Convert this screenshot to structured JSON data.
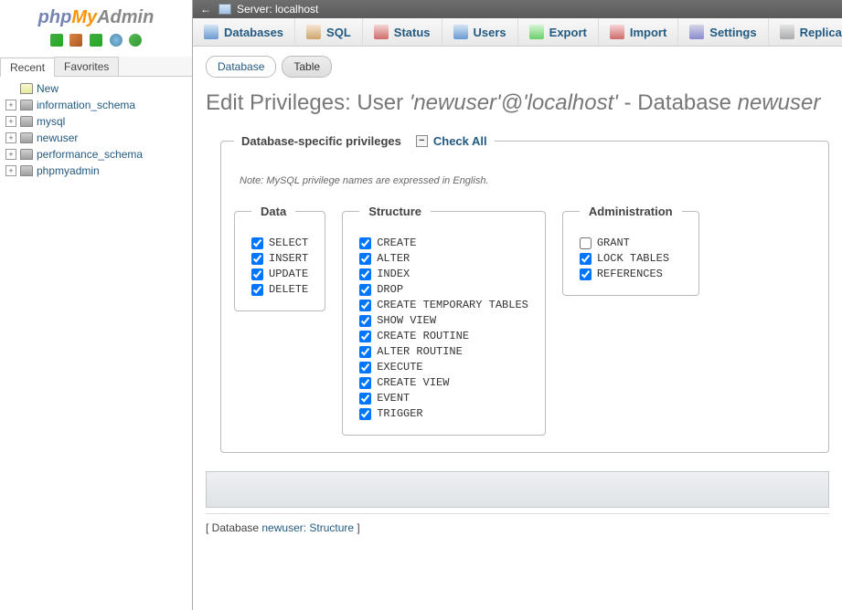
{
  "logo": {
    "php": "php",
    "my": "My",
    "admin": "Admin"
  },
  "sidebar": {
    "tabs": {
      "recent": "Recent",
      "favorites": "Favorites"
    },
    "items": [
      {
        "label": "New",
        "new": true
      },
      {
        "label": "information_schema"
      },
      {
        "label": "mysql"
      },
      {
        "label": "newuser"
      },
      {
        "label": "performance_schema"
      },
      {
        "label": "phpmyadmin"
      }
    ]
  },
  "topbar": {
    "arrow": "←",
    "server_label": "Server: localhost"
  },
  "menu": [
    {
      "key": "databases",
      "label": "Databases",
      "icon": "mi-db"
    },
    {
      "key": "sql",
      "label": "SQL",
      "icon": "mi-sql"
    },
    {
      "key": "status",
      "label": "Status",
      "icon": "mi-status"
    },
    {
      "key": "users",
      "label": "Users",
      "icon": "mi-users"
    },
    {
      "key": "export",
      "label": "Export",
      "icon": "mi-export"
    },
    {
      "key": "import",
      "label": "Import",
      "icon": "mi-import"
    },
    {
      "key": "settings",
      "label": "Settings",
      "icon": "mi-settings"
    },
    {
      "key": "replication",
      "label": "Replication",
      "icon": "mi-repl"
    }
  ],
  "subtabs": {
    "database": "Database",
    "table": "Table"
  },
  "title": {
    "prefix": "Edit Privileges: User ",
    "user": "'newuser'@'localhost'",
    "mid": " - Database ",
    "db": "newuser"
  },
  "fieldset": {
    "legend": "Database-specific privileges",
    "collapse": "−",
    "checkall": "Check All",
    "note": "Note: MySQL privilege names are expressed in English."
  },
  "groups": {
    "data": {
      "legend": "Data",
      "items": [
        {
          "label": "SELECT",
          "checked": true
        },
        {
          "label": "INSERT",
          "checked": true
        },
        {
          "label": "UPDATE",
          "checked": true
        },
        {
          "label": "DELETE",
          "checked": true
        }
      ]
    },
    "structure": {
      "legend": "Structure",
      "items": [
        {
          "label": "CREATE",
          "checked": true
        },
        {
          "label": "ALTER",
          "checked": true
        },
        {
          "label": "INDEX",
          "checked": true
        },
        {
          "label": "DROP",
          "checked": true
        },
        {
          "label": "CREATE TEMPORARY TABLES",
          "checked": true
        },
        {
          "label": "SHOW VIEW",
          "checked": true
        },
        {
          "label": "CREATE ROUTINE",
          "checked": true
        },
        {
          "label": "ALTER ROUTINE",
          "checked": true
        },
        {
          "label": "EXECUTE",
          "checked": true
        },
        {
          "label": "CREATE VIEW",
          "checked": true
        },
        {
          "label": "EVENT",
          "checked": true
        },
        {
          "label": "TRIGGER",
          "checked": true
        }
      ]
    },
    "administration": {
      "legend": "Administration",
      "items": [
        {
          "label": "GRANT",
          "checked": false
        },
        {
          "label": "LOCK TABLES",
          "checked": true
        },
        {
          "label": "REFERENCES",
          "checked": true
        }
      ]
    }
  },
  "footer": {
    "open": "[ Database ",
    "link": "newuser: Structure",
    "close": " ]"
  }
}
